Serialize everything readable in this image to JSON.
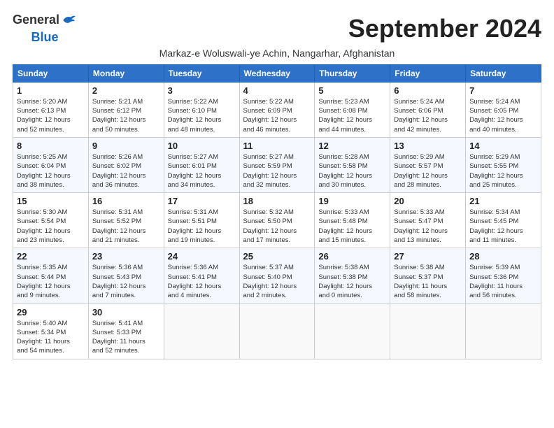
{
  "logo": {
    "line1": "General",
    "line2": "Blue"
  },
  "title": "September 2024",
  "subtitle": "Markaz-e Woluswali-ye Achin, Nangarhar, Afghanistan",
  "headers": [
    "Sunday",
    "Monday",
    "Tuesday",
    "Wednesday",
    "Thursday",
    "Friday",
    "Saturday"
  ],
  "weeks": [
    [
      {
        "day": "1",
        "info": "Sunrise: 5:20 AM\nSunset: 6:13 PM\nDaylight: 12 hours\nand 52 minutes."
      },
      {
        "day": "2",
        "info": "Sunrise: 5:21 AM\nSunset: 6:12 PM\nDaylight: 12 hours\nand 50 minutes."
      },
      {
        "day": "3",
        "info": "Sunrise: 5:22 AM\nSunset: 6:10 PM\nDaylight: 12 hours\nand 48 minutes."
      },
      {
        "day": "4",
        "info": "Sunrise: 5:22 AM\nSunset: 6:09 PM\nDaylight: 12 hours\nand 46 minutes."
      },
      {
        "day": "5",
        "info": "Sunrise: 5:23 AM\nSunset: 6:08 PM\nDaylight: 12 hours\nand 44 minutes."
      },
      {
        "day": "6",
        "info": "Sunrise: 5:24 AM\nSunset: 6:06 PM\nDaylight: 12 hours\nand 42 minutes."
      },
      {
        "day": "7",
        "info": "Sunrise: 5:24 AM\nSunset: 6:05 PM\nDaylight: 12 hours\nand 40 minutes."
      }
    ],
    [
      {
        "day": "8",
        "info": "Sunrise: 5:25 AM\nSunset: 6:04 PM\nDaylight: 12 hours\nand 38 minutes."
      },
      {
        "day": "9",
        "info": "Sunrise: 5:26 AM\nSunset: 6:02 PM\nDaylight: 12 hours\nand 36 minutes."
      },
      {
        "day": "10",
        "info": "Sunrise: 5:27 AM\nSunset: 6:01 PM\nDaylight: 12 hours\nand 34 minutes."
      },
      {
        "day": "11",
        "info": "Sunrise: 5:27 AM\nSunset: 5:59 PM\nDaylight: 12 hours\nand 32 minutes."
      },
      {
        "day": "12",
        "info": "Sunrise: 5:28 AM\nSunset: 5:58 PM\nDaylight: 12 hours\nand 30 minutes."
      },
      {
        "day": "13",
        "info": "Sunrise: 5:29 AM\nSunset: 5:57 PM\nDaylight: 12 hours\nand 28 minutes."
      },
      {
        "day": "14",
        "info": "Sunrise: 5:29 AM\nSunset: 5:55 PM\nDaylight: 12 hours\nand 25 minutes."
      }
    ],
    [
      {
        "day": "15",
        "info": "Sunrise: 5:30 AM\nSunset: 5:54 PM\nDaylight: 12 hours\nand 23 minutes."
      },
      {
        "day": "16",
        "info": "Sunrise: 5:31 AM\nSunset: 5:52 PM\nDaylight: 12 hours\nand 21 minutes."
      },
      {
        "day": "17",
        "info": "Sunrise: 5:31 AM\nSunset: 5:51 PM\nDaylight: 12 hours\nand 19 minutes."
      },
      {
        "day": "18",
        "info": "Sunrise: 5:32 AM\nSunset: 5:50 PM\nDaylight: 12 hours\nand 17 minutes."
      },
      {
        "day": "19",
        "info": "Sunrise: 5:33 AM\nSunset: 5:48 PM\nDaylight: 12 hours\nand 15 minutes."
      },
      {
        "day": "20",
        "info": "Sunrise: 5:33 AM\nSunset: 5:47 PM\nDaylight: 12 hours\nand 13 minutes."
      },
      {
        "day": "21",
        "info": "Sunrise: 5:34 AM\nSunset: 5:45 PM\nDaylight: 12 hours\nand 11 minutes."
      }
    ],
    [
      {
        "day": "22",
        "info": "Sunrise: 5:35 AM\nSunset: 5:44 PM\nDaylight: 12 hours\nand 9 minutes."
      },
      {
        "day": "23",
        "info": "Sunrise: 5:36 AM\nSunset: 5:43 PM\nDaylight: 12 hours\nand 7 minutes."
      },
      {
        "day": "24",
        "info": "Sunrise: 5:36 AM\nSunset: 5:41 PM\nDaylight: 12 hours\nand 4 minutes."
      },
      {
        "day": "25",
        "info": "Sunrise: 5:37 AM\nSunset: 5:40 PM\nDaylight: 12 hours\nand 2 minutes."
      },
      {
        "day": "26",
        "info": "Sunrise: 5:38 AM\nSunset: 5:38 PM\nDaylight: 12 hours\nand 0 minutes."
      },
      {
        "day": "27",
        "info": "Sunrise: 5:38 AM\nSunset: 5:37 PM\nDaylight: 11 hours\nand 58 minutes."
      },
      {
        "day": "28",
        "info": "Sunrise: 5:39 AM\nSunset: 5:36 PM\nDaylight: 11 hours\nand 56 minutes."
      }
    ],
    [
      {
        "day": "29",
        "info": "Sunrise: 5:40 AM\nSunset: 5:34 PM\nDaylight: 11 hours\nand 54 minutes."
      },
      {
        "day": "30",
        "info": "Sunrise: 5:41 AM\nSunset: 5:33 PM\nDaylight: 11 hours\nand 52 minutes."
      },
      null,
      null,
      null,
      null,
      null
    ]
  ]
}
